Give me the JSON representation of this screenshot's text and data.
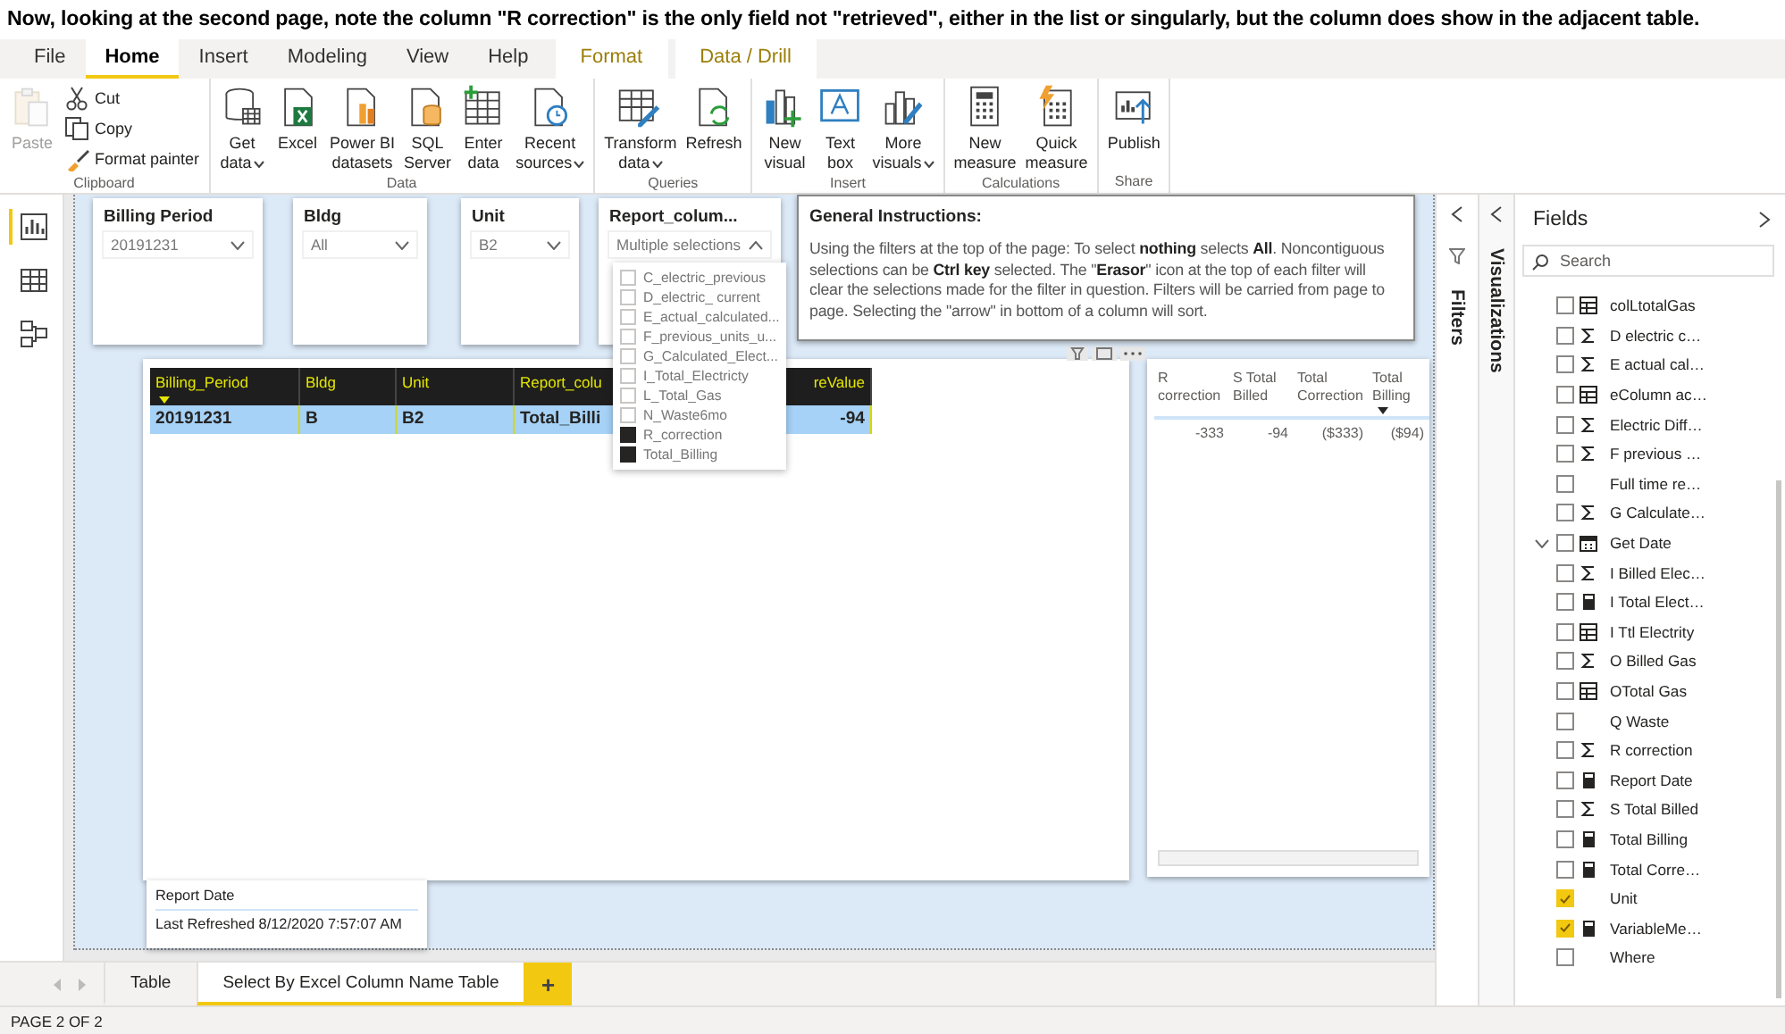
{
  "caption": "Now, looking at the second page, note the column \"R correction\" is the only field not \"retrieved\", either in the list or singularly, but the column does show in the adjacent table.",
  "menu_tabs": [
    {
      "label": "File",
      "selected": false,
      "kind": "standard"
    },
    {
      "label": "Home",
      "selected": true,
      "kind": "standard"
    },
    {
      "label": "Insert",
      "selected": false,
      "kind": "standard"
    },
    {
      "label": "Modeling",
      "selected": false,
      "kind": "standard"
    },
    {
      "label": "View",
      "selected": false,
      "kind": "standard"
    },
    {
      "label": "Help",
      "selected": false,
      "kind": "standard"
    },
    {
      "label": "Format",
      "selected": false,
      "kind": "contextual"
    },
    {
      "label": "Data / Drill",
      "selected": false,
      "kind": "contextual"
    }
  ],
  "ribbon_groups": [
    {
      "label": "Clipboard",
      "items": [
        {
          "label": "Paste",
          "kind": "large",
          "disabled": true,
          "dropdown": false
        },
        {
          "label": "Cut",
          "kind": "small",
          "disabled": false,
          "dropdown": false
        },
        {
          "label": "Copy",
          "kind": "small",
          "disabled": false,
          "dropdown": false
        },
        {
          "label": "Format painter",
          "kind": "small",
          "disabled": false,
          "dropdown": false
        }
      ]
    },
    {
      "label": "Data",
      "items": [
        {
          "label": "Get\ndata",
          "kind": "large",
          "disabled": false,
          "dropdown": true
        },
        {
          "label": "Excel",
          "kind": "large",
          "disabled": false,
          "dropdown": false
        },
        {
          "label": "Power BI\ndatasets",
          "kind": "large",
          "disabled": false,
          "dropdown": false
        },
        {
          "label": "SQL\nServer",
          "kind": "large",
          "disabled": false,
          "dropdown": false
        },
        {
          "label": "Enter\ndata",
          "kind": "large",
          "disabled": false,
          "dropdown": false
        },
        {
          "label": "Recent\nsources",
          "kind": "large",
          "disabled": false,
          "dropdown": true
        }
      ]
    },
    {
      "label": "Queries",
      "items": [
        {
          "label": "Transform\ndata",
          "kind": "large",
          "disabled": false,
          "dropdown": true
        },
        {
          "label": "Refresh",
          "kind": "large",
          "disabled": false,
          "dropdown": false
        }
      ]
    },
    {
      "label": "Insert",
      "items": [
        {
          "label": "New\nvisual",
          "kind": "large",
          "disabled": false,
          "dropdown": false
        },
        {
          "label": "Text\nbox",
          "kind": "large",
          "disabled": false,
          "dropdown": false
        },
        {
          "label": "More\nvisuals",
          "kind": "large",
          "disabled": false,
          "dropdown": true
        }
      ]
    },
    {
      "label": "Calculations",
      "items": [
        {
          "label": "New\nmeasure",
          "kind": "large",
          "disabled": false,
          "dropdown": false
        },
        {
          "label": "Quick\nmeasure",
          "kind": "large",
          "disabled": false,
          "dropdown": false
        }
      ]
    },
    {
      "label": "Share",
      "items": [
        {
          "label": "Publish",
          "kind": "large",
          "disabled": false,
          "dropdown": false
        }
      ]
    }
  ],
  "view_rail": [
    {
      "selected": true
    },
    {
      "selected": false
    },
    {
      "selected": false
    }
  ],
  "slicers": [
    {
      "title": "Billing Period",
      "value": "20191231",
      "expanded": false
    },
    {
      "title": "Bldg",
      "value": "All",
      "expanded": false
    },
    {
      "title": "Unit",
      "value": "B2",
      "expanded": false
    },
    {
      "title": "Report_colum...",
      "value": "Multiple selections",
      "expanded": true,
      "options": [
        {
          "label": "C_electric_previous",
          "checked": false
        },
        {
          "label": "D_electric_ current",
          "checked": false
        },
        {
          "label": "E_actual_calculated...",
          "checked": false
        },
        {
          "label": "F_previous_units_u...",
          "checked": false
        },
        {
          "label": "G_Calculated_Elect...",
          "checked": false
        },
        {
          "label": "I_Total_Electricty",
          "checked": false
        },
        {
          "label": "L_Total_Gas",
          "checked": false
        },
        {
          "label": "N_Waste6mo",
          "checked": false
        },
        {
          "label": "R_correction",
          "checked": true
        },
        {
          "label": "Total_Billing",
          "checked": true
        }
      ]
    }
  ],
  "instructions": {
    "title": "General Instructions:",
    "body": "Using the filters at the top of the page:  To select **nothing** selects **All**. Noncontiguous selections can be **Ctrl key** selected. The \"**Erasor**\" icon at the top of each filter will clear the selections made for the filter in question.  Filters will be carried from page to page. Selecting the \"arrow\" in bottom of a column will sort."
  },
  "main_table": {
    "columns": [
      {
        "label": "Billing_Period",
        "sorted": true
      },
      {
        "label": "Bldg",
        "sorted": false
      },
      {
        "label": "Unit",
        "sorted": false
      },
      {
        "label": "Report_colu",
        "sorted": false
      },
      {
        "label": "reValue",
        "sorted": false
      }
    ],
    "rows": [
      {
        "selected": true,
        "cells": [
          "20191231",
          "B",
          "B2",
          "Total_Billi",
          "-94"
        ]
      }
    ]
  },
  "side_table": {
    "columns": [
      {
        "label": "R correction",
        "sorted": false
      },
      {
        "label": "S Total Billed",
        "sorted": false
      },
      {
        "label": "Total Correction",
        "sorted": false
      },
      {
        "label": "Total Billing",
        "sorted": true
      }
    ],
    "rows": [
      [
        "-333",
        "-94",
        "($333)",
        "($94)"
      ]
    ]
  },
  "report_date_card": {
    "title": "Report Date",
    "value": "Last Refreshed 8/12/2020 7:57:07 AM"
  },
  "filters_pane": {
    "title": "Filters"
  },
  "visualizations_pane": {
    "title": "Visualizations"
  },
  "fields_pane": {
    "title": "Fields",
    "search": {
      "placeholder": "Search"
    },
    "items": [
      {
        "label": "colLtotalGas",
        "kind": "table",
        "checked": false,
        "expanded": false
      },
      {
        "label": "D electric c…",
        "kind": "sum",
        "checked": false,
        "expanded": false
      },
      {
        "label": "E actual cal…",
        "kind": "sum",
        "checked": false,
        "expanded": false
      },
      {
        "label": "eColumn ac…",
        "kind": "table",
        "checked": false,
        "expanded": false
      },
      {
        "label": "Electric Diff…",
        "kind": "sum",
        "checked": false,
        "expanded": false
      },
      {
        "label": "F previous …",
        "kind": "sum",
        "checked": false,
        "expanded": false
      },
      {
        "label": "Full time re…",
        "kind": "none",
        "checked": false,
        "expanded": false
      },
      {
        "label": "G Calculate…",
        "kind": "sum",
        "checked": false,
        "expanded": false
      },
      {
        "label": "Get Date",
        "kind": "date",
        "checked": false,
        "expanded": true
      },
      {
        "label": "I Billed Elec…",
        "kind": "sum",
        "checked": false,
        "expanded": false
      },
      {
        "label": "I Total Elect…",
        "kind": "calc",
        "checked": false,
        "expanded": false
      },
      {
        "label": "I Ttl Electrity",
        "kind": "table",
        "checked": false,
        "expanded": false
      },
      {
        "label": "O Billed Gas",
        "kind": "sum",
        "checked": false,
        "expanded": false
      },
      {
        "label": "OTotal Gas",
        "kind": "table",
        "checked": false,
        "expanded": false
      },
      {
        "label": "Q Waste",
        "kind": "none",
        "checked": false,
        "expanded": false
      },
      {
        "label": "R correction",
        "kind": "sum",
        "checked": false,
        "expanded": false
      },
      {
        "label": "Report Date",
        "kind": "calc",
        "checked": false,
        "expanded": false
      },
      {
        "label": "S Total Billed",
        "kind": "sum",
        "checked": false,
        "expanded": false
      },
      {
        "label": "Total Billing",
        "kind": "calc",
        "checked": false,
        "expanded": false
      },
      {
        "label": "Total Corre…",
        "kind": "calc",
        "checked": false,
        "expanded": false
      },
      {
        "label": "Unit",
        "kind": "none",
        "checked": true,
        "expanded": false
      },
      {
        "label": "VariableMe…",
        "kind": "calc",
        "checked": true,
        "expanded": false
      },
      {
        "label": "Where",
        "kind": "none",
        "checked": false,
        "expanded": false
      }
    ]
  },
  "page_tabs": [
    {
      "label": "Table",
      "selected": false
    },
    {
      "label": "Select By Excel Column Name Table",
      "selected": true
    }
  ],
  "add_page": "+",
  "status_bar": "PAGE 2 OF 2"
}
